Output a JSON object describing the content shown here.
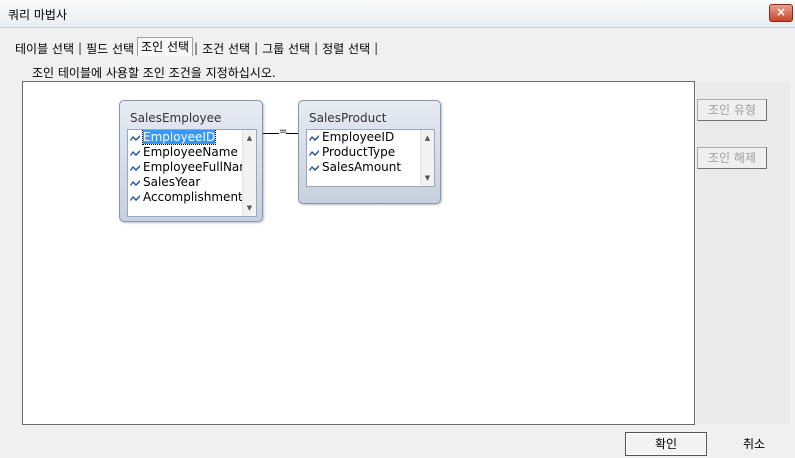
{
  "window": {
    "title": "쿼리 마법사",
    "close_label": "×"
  },
  "tabs": [
    {
      "label": "테이블 선택"
    },
    {
      "label": "필드 선택"
    },
    {
      "label": "조인 선택"
    },
    {
      "label": "조건 선택"
    },
    {
      "label": "그룹 선택"
    },
    {
      "label": "정렬 선택"
    }
  ],
  "active_tab": "조인 선택",
  "tab_separator": "|",
  "instruction": "조인 테이블에 사용할 조인 조건을 지정하십시오.",
  "tables": [
    {
      "name": "SalesEmployee",
      "fields": [
        "EmployeeID",
        "EmployeeName",
        "EmployeeFullName",
        "SalesYear",
        "Accomplishment"
      ],
      "selected_field": "EmployeeID"
    },
    {
      "name": "SalesProduct",
      "fields": [
        "EmployeeID",
        "ProductType",
        "SalesAmount"
      ]
    }
  ],
  "join": {
    "operator": "="
  },
  "side_buttons": {
    "join_type": "조인 유형",
    "join_remove": "조인 해제"
  },
  "footer": {
    "ok": "확인",
    "cancel": "취소"
  },
  "colors": {
    "selection": "#3399ff",
    "table_header": "#c7d0de",
    "close_button": "#c9442b"
  },
  "icons": {
    "field_icon": "key-icon",
    "scroll_up": "scroll-up-icon",
    "scroll_down": "scroll-down-icon"
  }
}
